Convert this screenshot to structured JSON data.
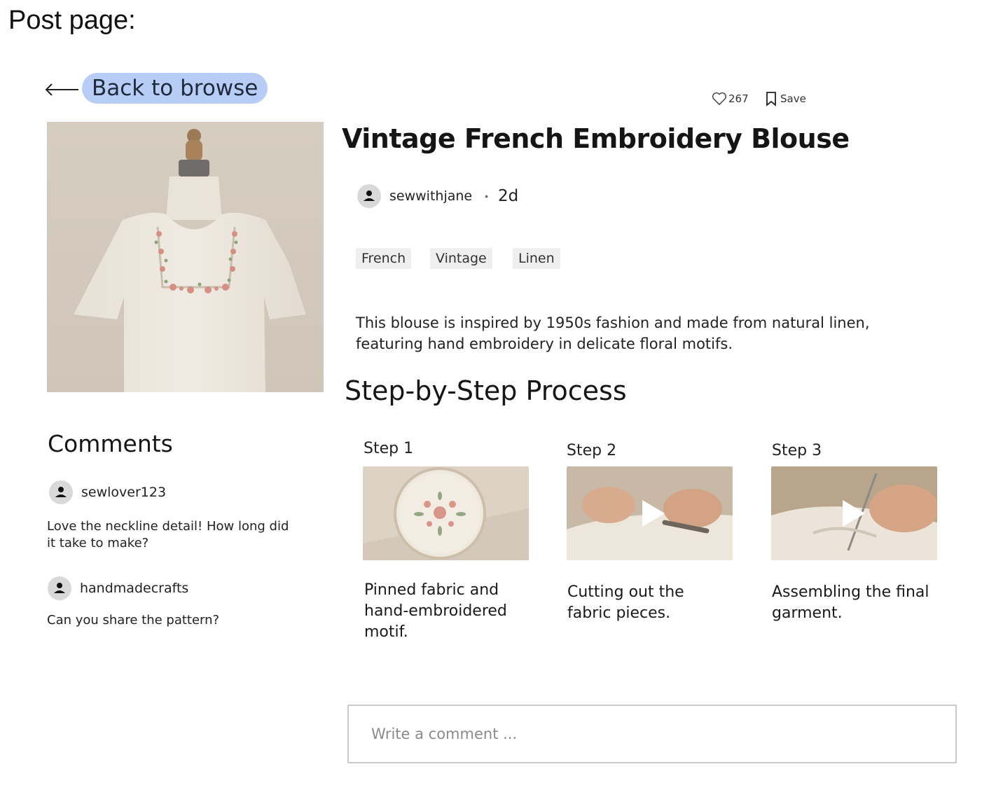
{
  "page": {
    "title": "Post page:"
  },
  "nav": {
    "back_label": "Back to browse"
  },
  "post": {
    "title": "Vintage French Embroidery Blouse",
    "likes": "267",
    "save_label": "Save",
    "author": "sewwithjane",
    "age": "2d",
    "tags": [
      "French",
      "Vintage",
      "Linen"
    ],
    "description": "This blouse is inspired by 1950s fashion and made from natural linen, featuring hand embroidery in delicate floral motifs."
  },
  "steps": {
    "heading": "Step-by-Step Process",
    "items": [
      {
        "label": "Step 1",
        "caption": "Pinned fabric and hand-embroidered motif.",
        "media": "image"
      },
      {
        "label": "Step 2",
        "caption": "Cutting out the fabric pieces.",
        "media": "video"
      },
      {
        "label": "Step 3",
        "caption": "Assembling the final garment.",
        "media": "video"
      }
    ]
  },
  "comments": {
    "heading": "Comments",
    "items": [
      {
        "user": "sewlover123",
        "text": "Love the neckline detail! How long did it take to make?"
      },
      {
        "user": "handmadecrafts",
        "text": "Can you share the pattern?"
      }
    ],
    "input_placeholder": "Write a comment ..."
  },
  "colors": {
    "back_button_bg": "#b7cdf5",
    "tag_bg": "#efefef",
    "photo_bg": "#d8cfc3"
  },
  "icons": {
    "back": "arrow-left-icon",
    "like": "heart-icon",
    "save": "bookmark-icon",
    "avatar": "user-icon",
    "play": "play-icon"
  }
}
